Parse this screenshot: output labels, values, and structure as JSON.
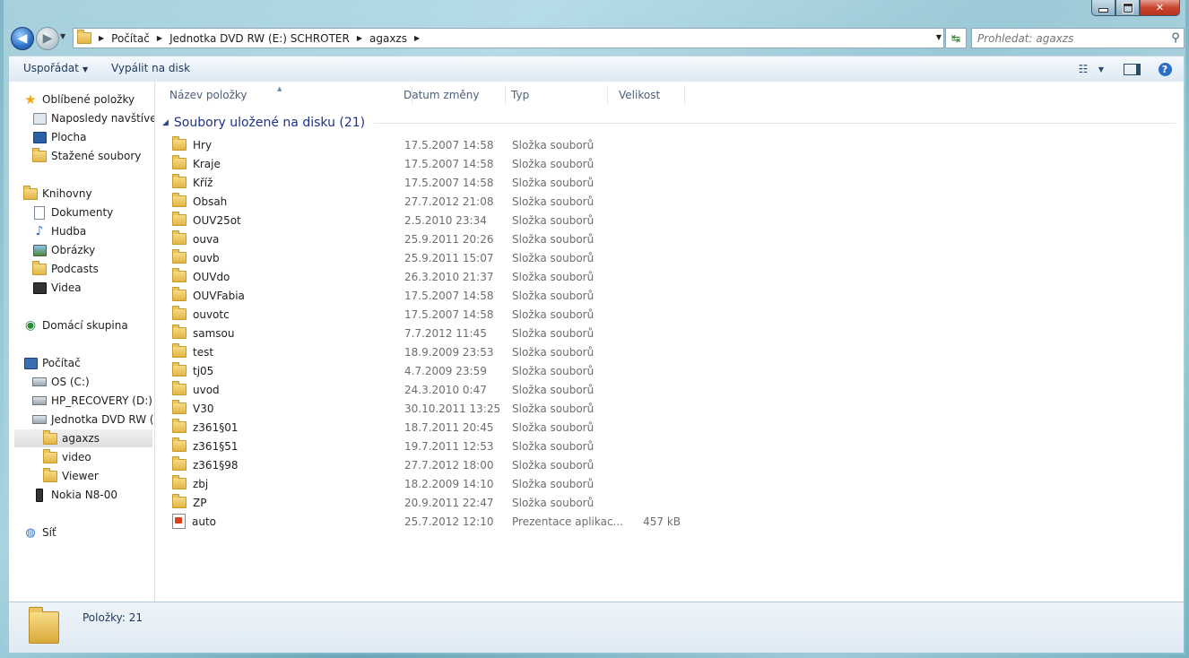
{
  "address": {
    "crumbs": [
      "Počítač",
      "Jednotka DVD RW (E:) SCHROTER",
      "agaxzs"
    ],
    "search_placeholder": "Prohledat: agaxzs"
  },
  "toolbar": {
    "organize_label": "Uspořádat",
    "burn_label": "Vypálit na disk"
  },
  "sidebar": {
    "items": [
      {
        "label": "Oblíbené položky",
        "icon": "star-icon"
      },
      {
        "label": "Naposledy navštívené",
        "icon": "recent-places-icon"
      },
      {
        "label": "Plocha",
        "icon": "desktop-icon"
      },
      {
        "label": "Stažené soubory",
        "icon": "downloads-folder-icon"
      },
      {
        "label": "Knihovny",
        "icon": "libraries-icon"
      },
      {
        "label": "Dokumenty",
        "icon": "documents-icon"
      },
      {
        "label": "Hudba",
        "icon": "music-icon"
      },
      {
        "label": "Obrázky",
        "icon": "pictures-icon"
      },
      {
        "label": "Podcasts",
        "icon": "folder-icon"
      },
      {
        "label": "Videa",
        "icon": "videos-icon"
      },
      {
        "label": "Domácí skupina",
        "icon": "homegroup-icon"
      },
      {
        "label": "Počítač",
        "icon": "computer-icon"
      },
      {
        "label": "OS (C:)",
        "icon": "drive-icon"
      },
      {
        "label": "HP_RECOVERY (D:)",
        "icon": "drive-icon"
      },
      {
        "label": "Jednotka DVD RW (E:",
        "icon": "dvd-drive-icon"
      },
      {
        "label": "agaxzs",
        "icon": "folder-icon"
      },
      {
        "label": "video",
        "icon": "folder-icon"
      },
      {
        "label": "Viewer",
        "icon": "folder-icon"
      },
      {
        "label": "Nokia N8-00",
        "icon": "phone-icon"
      },
      {
        "label": "Síť",
        "icon": "network-icon"
      }
    ]
  },
  "columns": {
    "name": "Název položky",
    "date": "Datum změny",
    "type": "Typ",
    "size": "Velikost"
  },
  "group": {
    "title": "Soubory uložené na disku (21)"
  },
  "files": [
    {
      "name": "Hry",
      "date": "17.5.2007 14:58",
      "type": "Složka souborů",
      "size": ""
    },
    {
      "name": "Kraje",
      "date": "17.5.2007 14:58",
      "type": "Složka souborů",
      "size": ""
    },
    {
      "name": "Kříž",
      "date": "17.5.2007 14:58",
      "type": "Složka souborů",
      "size": ""
    },
    {
      "name": "Obsah",
      "date": "27.7.2012 21:08",
      "type": "Složka souborů",
      "size": ""
    },
    {
      "name": "OUV25ot",
      "date": "2.5.2010 23:34",
      "type": "Složka souborů",
      "size": ""
    },
    {
      "name": "ouva",
      "date": "25.9.2011 20:26",
      "type": "Složka souborů",
      "size": ""
    },
    {
      "name": "ouvb",
      "date": "25.9.2011 15:07",
      "type": "Složka souborů",
      "size": ""
    },
    {
      "name": "OUVdo",
      "date": "26.3.2010 21:37",
      "type": "Složka souborů",
      "size": ""
    },
    {
      "name": "OUVFabia",
      "date": "17.5.2007 14:58",
      "type": "Složka souborů",
      "size": ""
    },
    {
      "name": "ouvotc",
      "date": "17.5.2007 14:58",
      "type": "Složka souborů",
      "size": ""
    },
    {
      "name": "samsou",
      "date": "7.7.2012 11:45",
      "type": "Složka souborů",
      "size": ""
    },
    {
      "name": "test",
      "date": "18.9.2009 23:53",
      "type": "Složka souborů",
      "size": ""
    },
    {
      "name": "tj05",
      "date": "4.7.2009 23:59",
      "type": "Složka souborů",
      "size": ""
    },
    {
      "name": "uvod",
      "date": "24.3.2010 0:47",
      "type": "Složka souborů",
      "size": ""
    },
    {
      "name": "V30",
      "date": "30.10.2011 13:25",
      "type": "Složka souborů",
      "size": ""
    },
    {
      "name": "z361§01",
      "date": "18.7.2011 20:45",
      "type": "Složka souborů",
      "size": ""
    },
    {
      "name": "z361§51",
      "date": "19.7.2011 12:53",
      "type": "Složka souborů",
      "size": ""
    },
    {
      "name": "z361§98",
      "date": "27.7.2012 18:00",
      "type": "Složka souborů",
      "size": ""
    },
    {
      "name": "zbj",
      "date": "18.2.2009 14:10",
      "type": "Složka souborů",
      "size": ""
    },
    {
      "name": "ZP",
      "date": "20.9.2011 22:47",
      "type": "Složka souborů",
      "size": ""
    },
    {
      "name": "auto",
      "date": "25.7.2012 12:10",
      "type": "Prezentace aplikac...",
      "size": "457 kB"
    }
  ],
  "status": {
    "items_text": "Položky: 21"
  }
}
